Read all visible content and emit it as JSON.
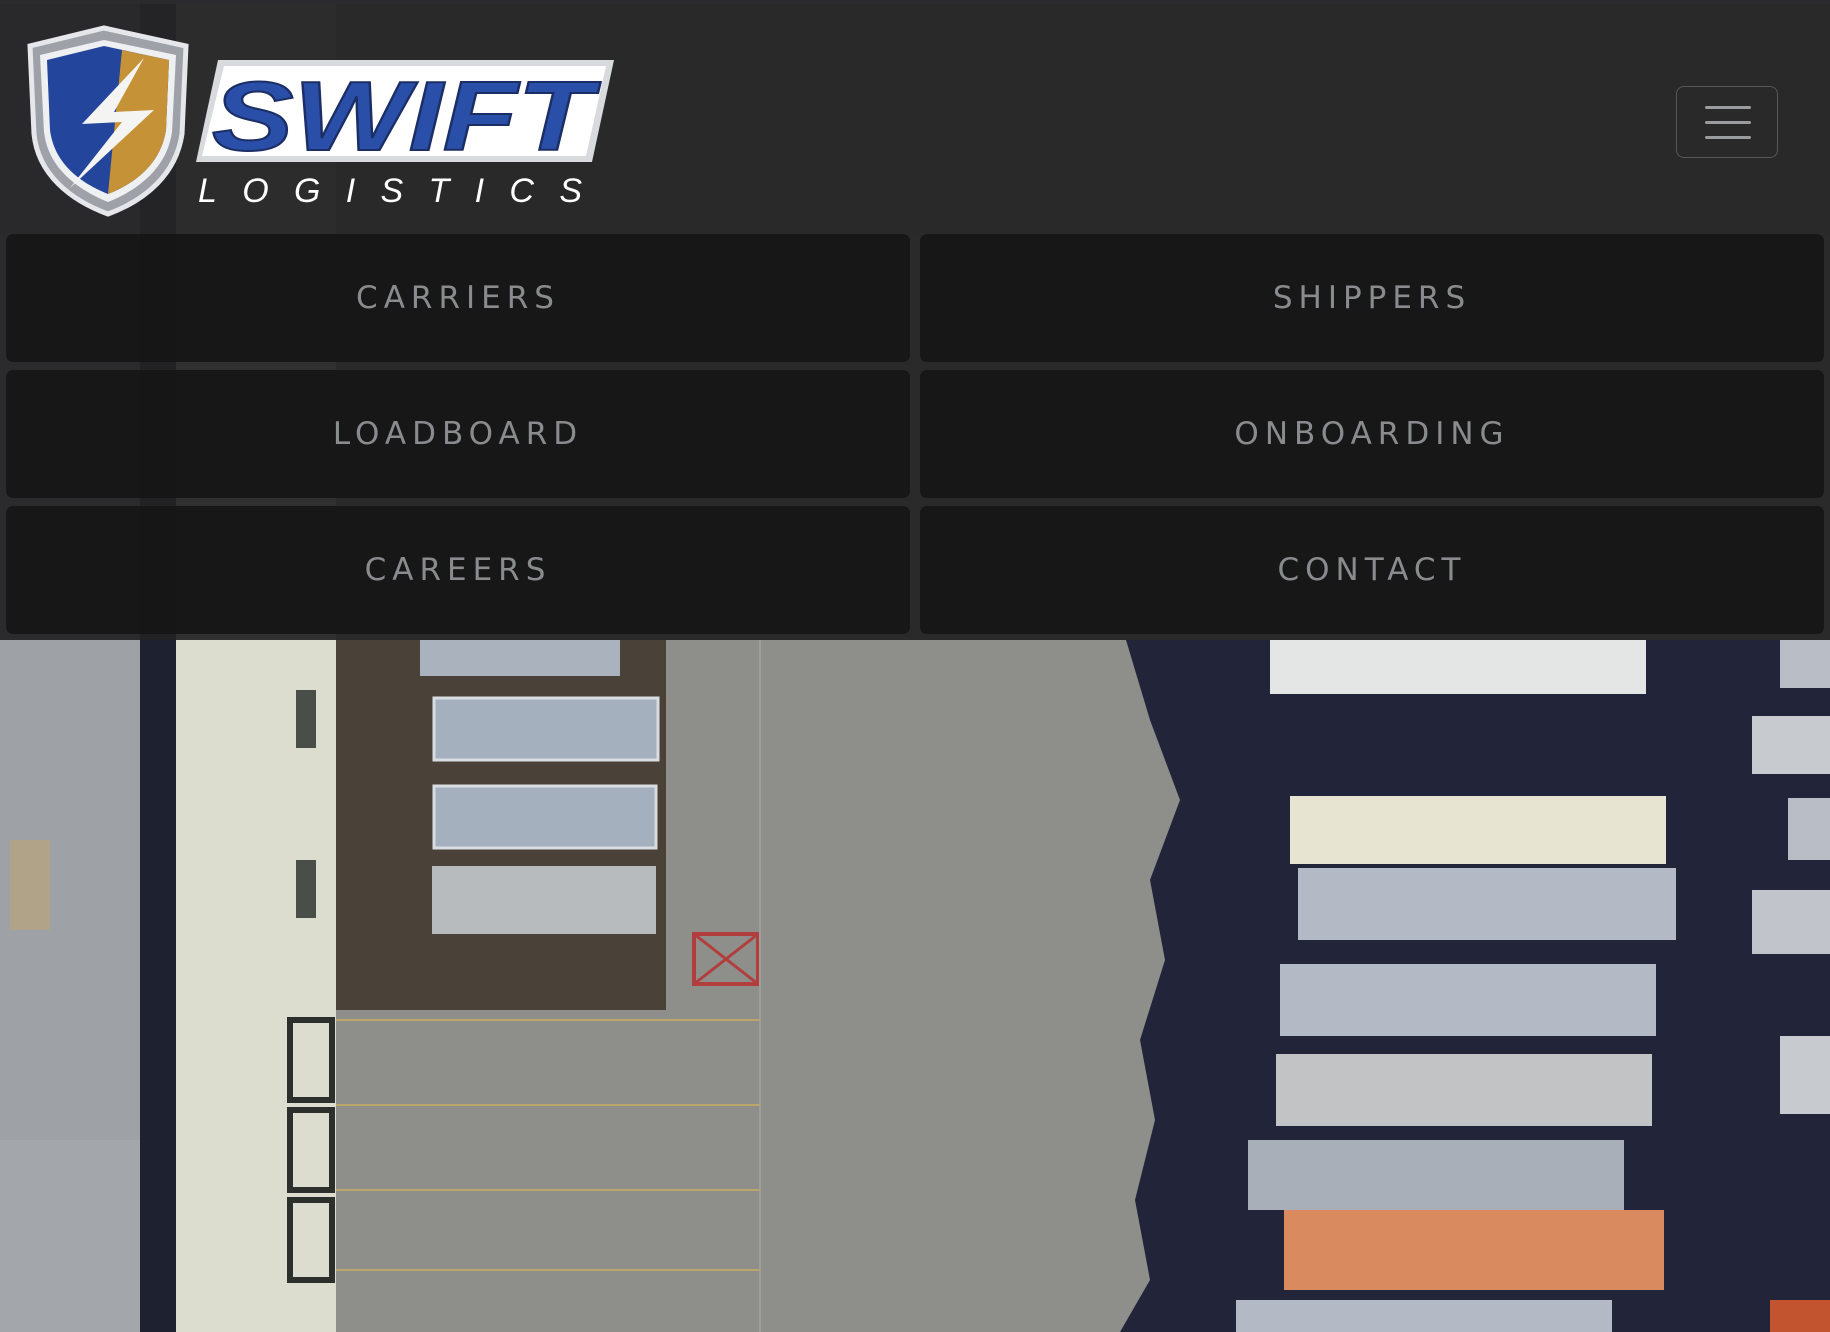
{
  "brand": {
    "logo_word": "SWIFT",
    "logo_subword": "LOGISTICS",
    "colors": {
      "blue": "#2a4fa8",
      "gold": "#c9972e",
      "silver": "#c7c9cc"
    }
  },
  "header": {
    "menu_toggle_icon": "hamburger-icon"
  },
  "nav": {
    "items": [
      {
        "label": "CARRIERS"
      },
      {
        "label": "SHIPPERS"
      },
      {
        "label": "LOADBOARD"
      },
      {
        "label": "ONBOARDING"
      },
      {
        "label": "CAREERS"
      },
      {
        "label": "CONTACT"
      }
    ]
  }
}
